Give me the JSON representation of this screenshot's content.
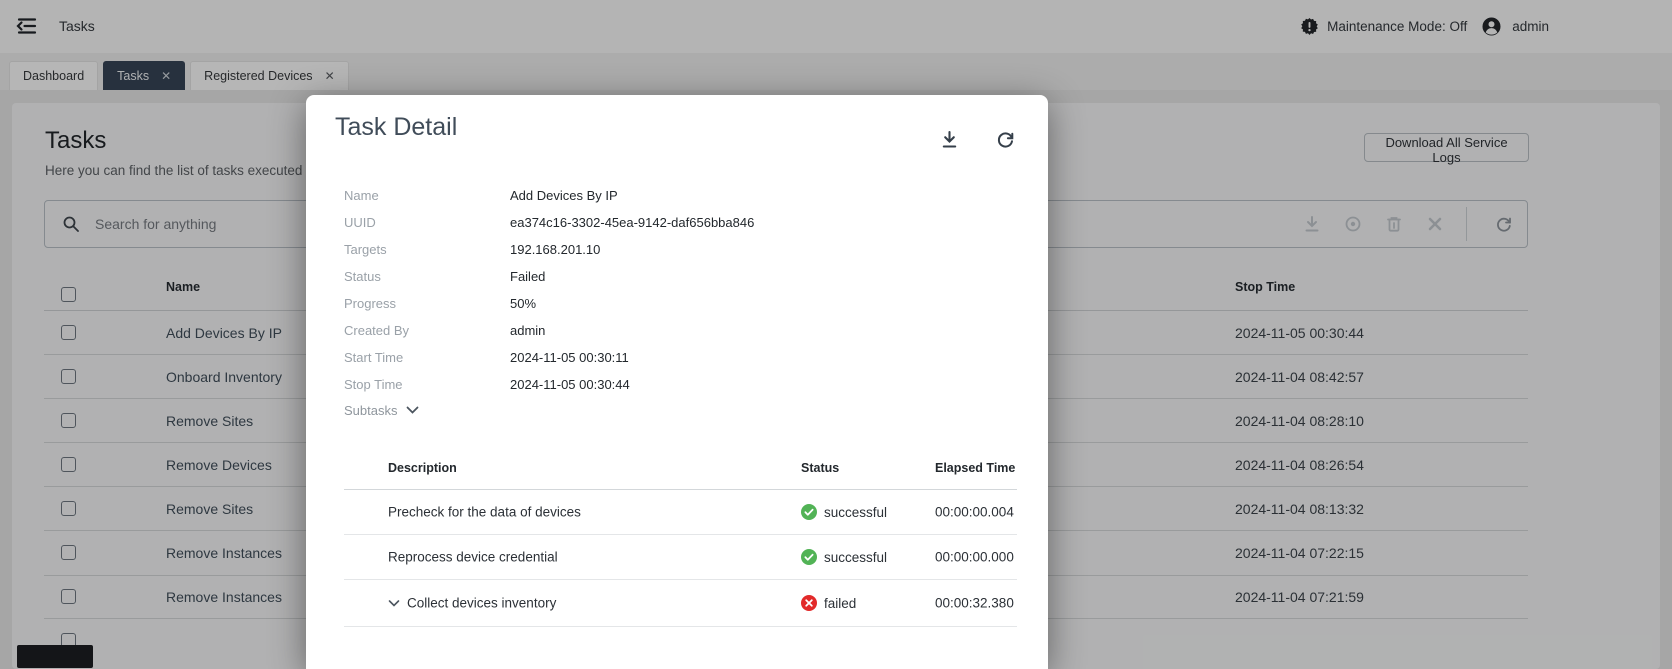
{
  "topbar": {
    "title": "Tasks",
    "maintenance_label": "Maintenance Mode: Off",
    "user": "admin"
  },
  "tabs": [
    {
      "label": "Dashboard"
    },
    {
      "label": "Tasks"
    },
    {
      "label": "Registered Devices"
    }
  ],
  "page": {
    "heading": "Tasks",
    "subtitle": "Here you can find the list of tasks executed by",
    "search_placeholder": "Search for anything",
    "download_logs_button": "Download All Service Logs"
  },
  "tasks_table": {
    "columns": {
      "name": "Name",
      "stop_time": "Stop Time"
    },
    "rows": [
      {
        "name": "Add Devices By IP",
        "stop_time": "2024-11-05 00:30:44"
      },
      {
        "name": "Onboard Inventory",
        "stop_time": "2024-11-04 08:42:57"
      },
      {
        "name": "Remove Sites",
        "stop_time": "2024-11-04 08:28:10"
      },
      {
        "name": "Remove Devices",
        "stop_time": "2024-11-04 08:26:54"
      },
      {
        "name": "Remove Sites",
        "stop_time": "2024-11-04 08:13:32"
      },
      {
        "name": "Remove Instances",
        "stop_time": "2024-11-04 07:22:15"
      },
      {
        "name": "Remove Instances",
        "stop_time": "2024-11-04 07:21:59"
      }
    ]
  },
  "modal": {
    "title": "Task Detail",
    "fields": [
      {
        "label": "Name",
        "value": "Add Devices By IP"
      },
      {
        "label": "UUID",
        "value": "ea374c16-3302-45ea-9142-daf656bba846"
      },
      {
        "label": "Targets",
        "value": "192.168.201.10"
      },
      {
        "label": "Status",
        "value": "Failed"
      },
      {
        "label": "Progress",
        "value": "50%"
      },
      {
        "label": "Created By",
        "value": "admin"
      },
      {
        "label": "Start Time",
        "value": "2024-11-05 00:30:11"
      },
      {
        "label": "Stop Time",
        "value": "2024-11-05 00:30:44"
      }
    ],
    "subtasks_label": "Subtasks",
    "subtask_table": {
      "columns": {
        "description": "Description",
        "status": "Status",
        "elapsed": "Elapsed Time"
      },
      "rows": [
        {
          "description": "Precheck for the data of devices",
          "status": "successful",
          "elapsed": "00:00:00.004"
        },
        {
          "description": "Reprocess device credential",
          "status": "successful",
          "elapsed": "00:00:00.000"
        },
        {
          "description": "Collect devices inventory",
          "status": "failed",
          "elapsed": "00:00:32.380"
        }
      ]
    }
  },
  "colors": {
    "success": "#52b356",
    "failed": "#e22a2a",
    "active_tab": "#374556"
  },
  "icons": {
    "menu": "sidebar-collapse",
    "maintenance": "badge-exclamation",
    "user": "avatar-person",
    "tab_close": "close-x",
    "search": "magnifier",
    "download": "arrow-down-with-bar",
    "details": "disc",
    "delete": "trash",
    "clear": "close-x",
    "refresh": "circular-arrow",
    "chevron": "chevron-down",
    "success": "check-circle",
    "failed": "x-circle"
  }
}
